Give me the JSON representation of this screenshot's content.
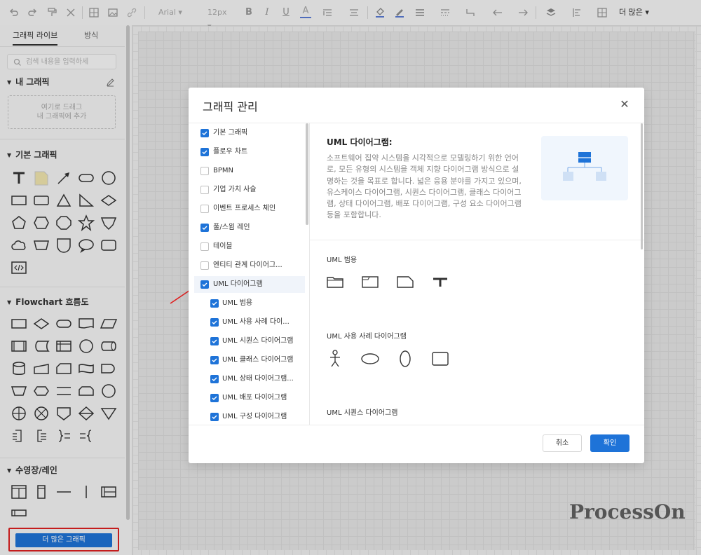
{
  "toolbar": {
    "font_name": "Arial",
    "font_size": "12px",
    "more_label": "더 많은"
  },
  "left_panel": {
    "tabs": [
      "그래픽 라이브",
      "방식"
    ],
    "search_placeholder": "검색 내용을 입력하세",
    "my_graphics_title": "내 그래픽",
    "drop_hint_line1": "여기로 드래그",
    "drop_hint_line2": "내 그래픽에 추가",
    "basic_title": "기본 그래픽",
    "flowchart_title": "Flowchart 흐름도",
    "swimlane_title": "수영장/레인",
    "more_graphics_button": "더 많은 그래픽"
  },
  "watermark": "ProcessOn",
  "dialog": {
    "title": "그래픽 관리",
    "items": [
      {
        "label": "기본 그래픽",
        "checked": true
      },
      {
        "label": "플로우 차트",
        "checked": true
      },
      {
        "label": "BPMN",
        "checked": false
      },
      {
        "label": "기업 가치 사슬",
        "checked": false
      },
      {
        "label": "이벤트 프로세스 체인",
        "checked": false
      },
      {
        "label": "풀/스윔 레인",
        "checked": true
      },
      {
        "label": "테이블",
        "checked": false
      },
      {
        "label": "엔티티 관계 다이어그...",
        "checked": false
      },
      {
        "label": "UML 다이어그램",
        "checked": true
      },
      {
        "label": "UML 범용",
        "checked": true
      },
      {
        "label": "UML 사용 사례 다이...",
        "checked": true
      },
      {
        "label": "UML 시퀀스 다이어그램",
        "checked": true
      },
      {
        "label": "UML 클래스 다이어그램",
        "checked": true
      },
      {
        "label": "UML 상태 다이어그램...",
        "checked": true
      },
      {
        "label": "UML 배포 다이어그램",
        "checked": true
      },
      {
        "label": "UML 구성 다이어그램",
        "checked": true
      }
    ],
    "detail_title": "UML 다이어그램:",
    "detail_description": "소프트웨어 집약 시스템을 시각적으로 모델링하기 위한 언어로, 모든 유형의 시스템을 객체 지향 다이어그램 방식으로 설명하는 것을 목표로 합니다. 넓은 응용 분야를 가지고 있으며, 유스케이스 다이어그램, 시퀀스 다이어그램, 클래스 다이어그램, 상태 다이어그램, 배포 다이어그램, 구성 요소 다이어그램 등을 포함합니다.",
    "groups": [
      "UML 범용",
      "UML 사용 사례 다이어그램",
      "UML 시퀀스 다이어그램"
    ],
    "cancel_label": "취소",
    "ok_label": "확인"
  },
  "colors": {
    "accent": "#1e73d8",
    "highlight_border": "#e02020"
  }
}
